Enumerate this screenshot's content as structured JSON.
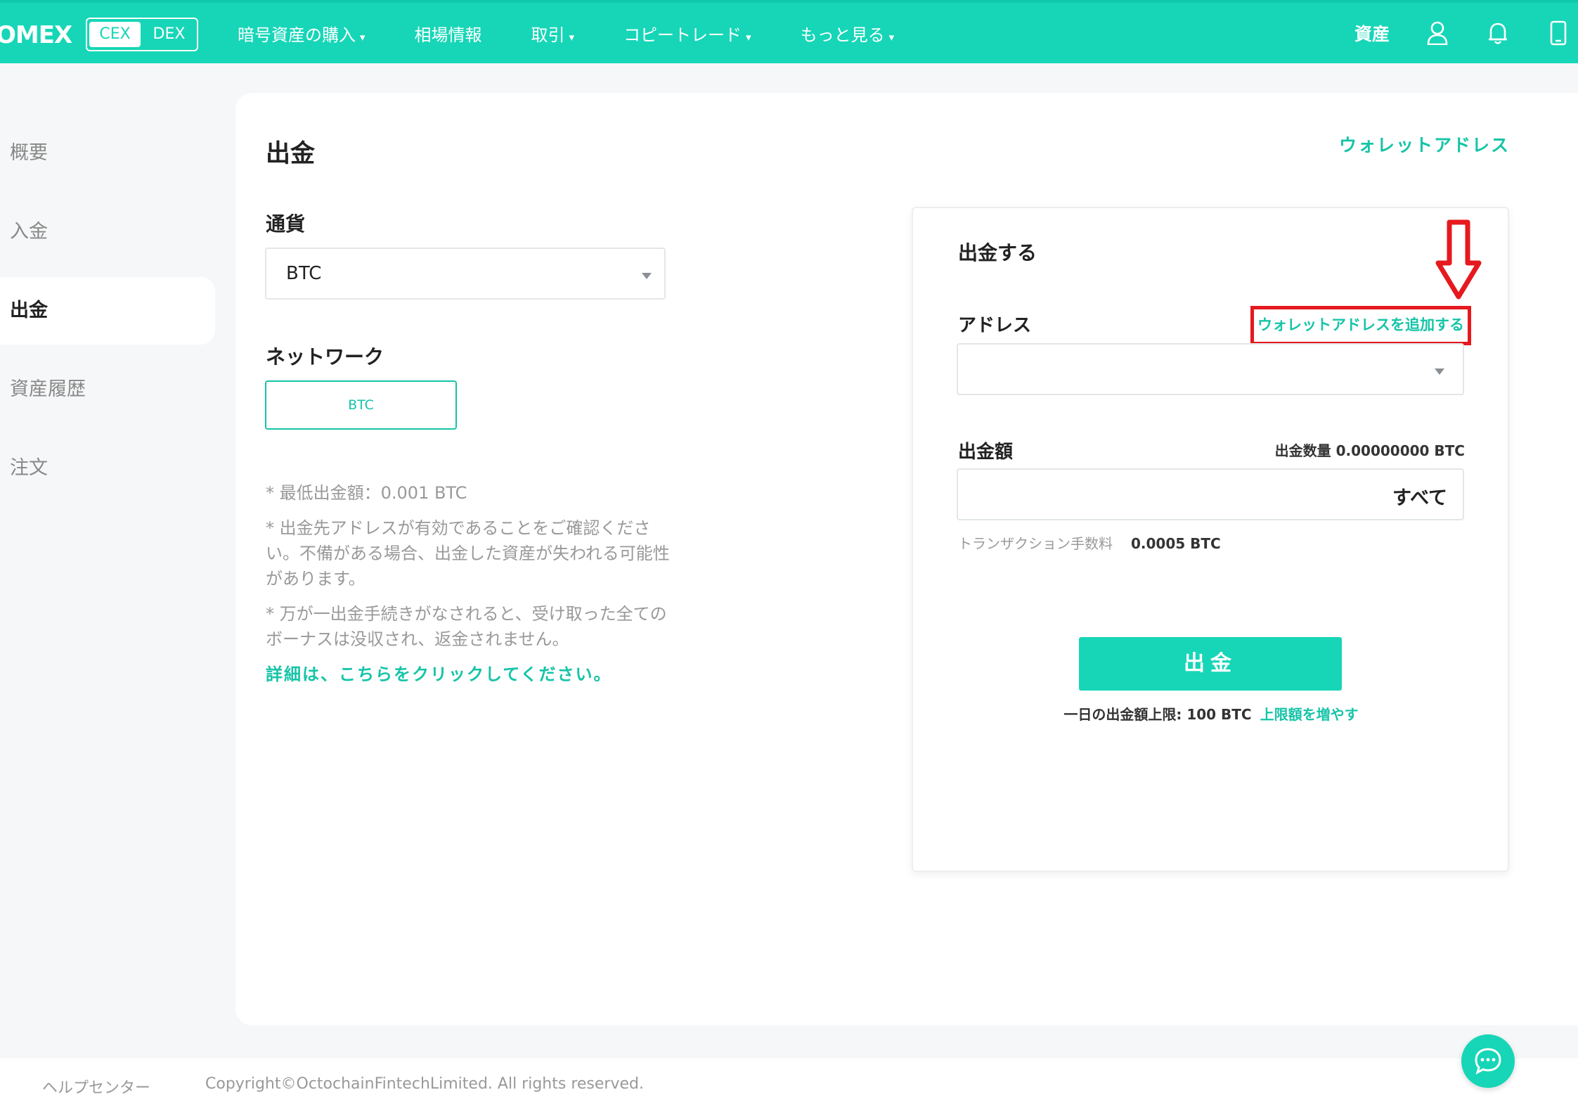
{
  "header": {
    "logo": "OMEX",
    "modes": [
      "CEX",
      "DEX"
    ],
    "active_mode": "CEX",
    "nav": [
      {
        "label": "暗号資産の購入",
        "has_caret": true
      },
      {
        "label": "相場情報",
        "has_caret": false
      },
      {
        "label": "取引",
        "has_caret": true
      },
      {
        "label": "コピートレード",
        "has_caret": true
      },
      {
        "label": "もっと見る",
        "has_caret": true
      }
    ],
    "caret": "▾",
    "assets_label": "資産",
    "icons": [
      "user-icon",
      "bell-icon",
      "mobile-icon"
    ]
  },
  "sidebar": {
    "items": [
      {
        "label": "概要",
        "active": false
      },
      {
        "label": "入金",
        "active": false
      },
      {
        "label": "出金",
        "active": true
      },
      {
        "label": "資産履歴",
        "active": false
      },
      {
        "label": "注文",
        "active": false
      }
    ]
  },
  "main": {
    "title": "出金",
    "wallet_address_link": "ウォレットアドレス",
    "currency": {
      "label": "通貨",
      "value": "BTC"
    },
    "network": {
      "label": "ネットワーク",
      "value": "BTC"
    },
    "notes": [
      "* 最低出金額：0.001 BTC",
      "* 出金先アドレスが有効であることをご確認ください。不備がある場合、出金した資産が失われる可能性があります。",
      "* 万が一出金手続きがなされると、受け取った全てのボーナスは没収され、返金されません。"
    ],
    "detail_link": "詳細は、こちらをクリックしてください。"
  },
  "withdraw_card": {
    "title": "出金する",
    "address_label": "アドレス",
    "add_wallet_link": "ウォレットアドレスを追加する",
    "address_value": "",
    "amount_label": "出金額",
    "amount_qty": "出金数量 0.00000000 BTC",
    "all_button": "すべて",
    "fee_label": "トランザクション手数料",
    "fee_value": "0.0005 BTC",
    "withdraw_button": "出金",
    "daily_limit": "一日の出金額上限: 100 BTC",
    "raise_limit_link": "上限額を増やす"
  },
  "annotation": {
    "arrow_icon": "red-down-arrow",
    "highlight_color": "#e5191e"
  },
  "footer": {
    "help": "ヘルプセンター",
    "copyright": "Copyright©OctochainFintechLimited. All rights reserved."
  },
  "colors": {
    "brand": "#16d6b7",
    "link": "#16c4a8",
    "annotation": "#e5191e"
  }
}
